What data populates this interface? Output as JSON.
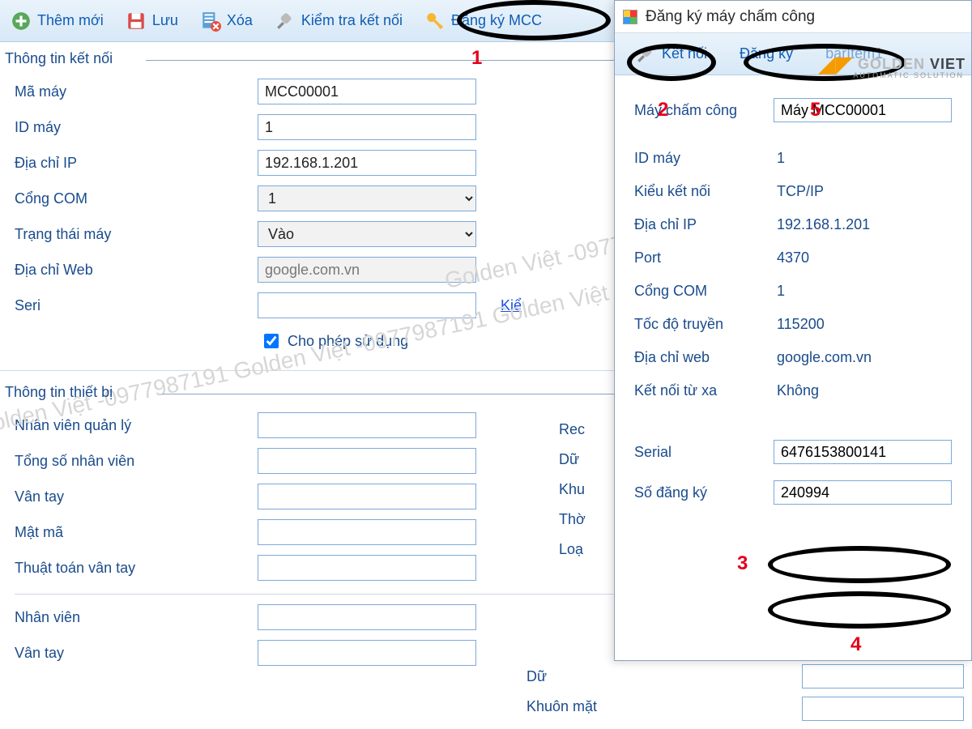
{
  "toolbar": {
    "new": "Thêm mới",
    "save": "Lưu",
    "delete": "Xóa",
    "testconn": "Kiểm tra kết nối",
    "regmcc": "Đăng ký MCC"
  },
  "section1": "Thông tin kết nối",
  "section2": "Thông tin thiết bị",
  "form": {
    "mamay_label": "Mã máy",
    "mamay_value": "MCC00001",
    "idmay_label": "ID máy",
    "idmay_value": "1",
    "ip_label": "Địa chỉ IP",
    "ip_value": "192.168.1.201",
    "com_label": "Cổng COM",
    "com_value": "1",
    "trangthai_label": "Trạng thái máy",
    "trangthai_value": "Vào",
    "web_label": "Địa chỉ Web",
    "web_value": "google.com.vn",
    "seri_label": "Seri",
    "seri_link": "Kiể",
    "allow_label": "Cho phép sử dụng",
    "nvql_label": "Nhân viên quản lý",
    "tongnv_label": "Tổng số nhân viên",
    "vantay_label": "Vân tay",
    "matma_label": "Mật mã",
    "ttvt_label": "Thuật toán vân tay",
    "nv_label": "Nhân viên",
    "vt2_label": "Vân tay"
  },
  "partial": {
    "rec": "Rec",
    "du": "Dữ",
    "khu": "Khu",
    "tho": "Thờ",
    "loa": "Loạ",
    "du2": "Dữ",
    "khuon": "Khuôn mặt"
  },
  "popup": {
    "title": "Đăng ký máy chấm công",
    "connect": "Kết nối",
    "register": "Đăng ký",
    "extra": "barItem1",
    "mcc_label": "Máy chấm công",
    "mcc_value": "Máy MCC00001",
    "id_label": "ID máy",
    "id_value": "1",
    "conn_label": "Kiểu kết nối",
    "conn_value": "TCP/IP",
    "ip_label": "Địa chỉ IP",
    "ip_value": "192.168.1.201",
    "port_label": "Port",
    "port_value": "4370",
    "com_label": "Cổng COM",
    "com_value": "1",
    "baud_label": "Tốc độ truyền",
    "baud_value": "115200",
    "web_label": "Địa chỉ web",
    "web_value": "google.com.vn",
    "remote_label": "Kết nối từ xa",
    "remote_value": "Không",
    "serial_label": "Serial",
    "serial_value": "6476153800141",
    "reg_label": "Số đăng ký",
    "reg_value": "240994"
  },
  "watermark": "Golden Việt -0977987191 Golden Việt -0977987191 Golden Việt -0977",
  "logo": {
    "a": "GOLDEN",
    "b": "VIET",
    "sub": "AUTOMATIC SOLUTION"
  },
  "annotations": {
    "n1": "1",
    "n2": "2",
    "n3": "3",
    "n4": "4",
    "n5": "5"
  }
}
